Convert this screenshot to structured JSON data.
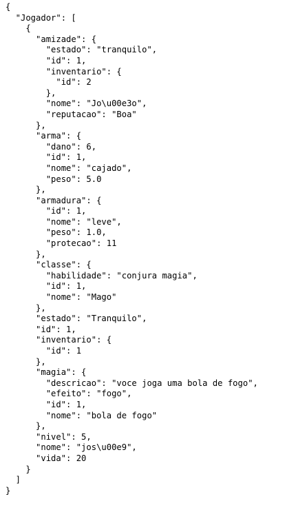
{
  "document": {
    "lines": [
      "{",
      "  \"Jogador\": [",
      "    {",
      "      \"amizade\": {",
      "        \"estado\": \"tranquilo\",",
      "        \"id\": 1,",
      "        \"inventario\": {",
      "          \"id\": 2",
      "        },",
      "        \"nome\": \"Jo\\u00e3o\",",
      "        \"reputacao\": \"Boa\"",
      "      },",
      "      \"arma\": {",
      "        \"dano\": 6,",
      "        \"id\": 1,",
      "        \"nome\": \"cajado\",",
      "        \"peso\": 5.0",
      "      },",
      "      \"armadura\": {",
      "        \"id\": 1,",
      "        \"nome\": \"leve\",",
      "        \"peso\": 1.0,",
      "        \"protecao\": 11",
      "      },",
      "      \"classe\": {",
      "        \"habilidade\": \"conjura magia\",",
      "        \"id\": 1,",
      "        \"nome\": \"Mago\"",
      "      },",
      "      \"estado\": \"Tranquilo\",",
      "      \"id\": 1,",
      "      \"inventario\": {",
      "        \"id\": 1",
      "      },",
      "      \"magia\": {",
      "        \"descricao\": \"voce joga uma bola de fogo\",",
      "        \"efeito\": \"fogo\",",
      "        \"id\": 1,",
      "        \"nome\": \"bola de fogo\"",
      "      },",
      "      \"nivel\": 5,",
      "      \"nome\": \"jos\\u00e9\",",
      "      \"vida\": 20",
      "    }",
      "  ]",
      "}"
    ]
  }
}
